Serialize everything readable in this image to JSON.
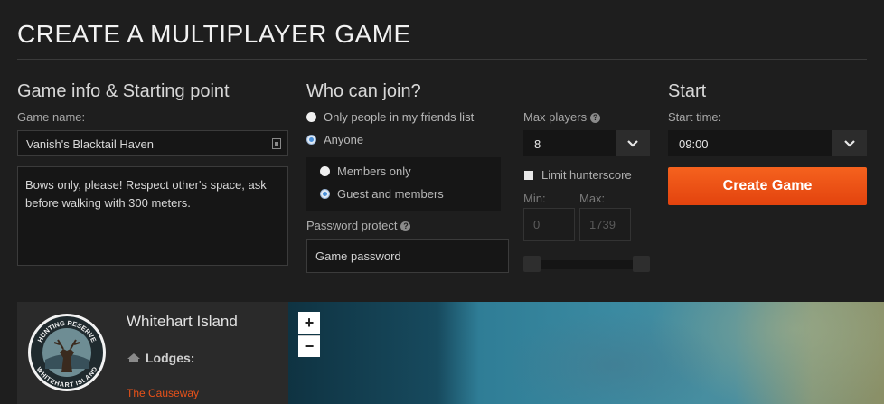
{
  "page": {
    "title": "CREATE A MULTIPLAYER GAME"
  },
  "game_info": {
    "heading": "Game info & Starting point",
    "name_label": "Game name:",
    "name_value": "Vanish's Blacktail Haven",
    "description_value": "Bows only, please! Respect other's space, ask before walking with 300 meters."
  },
  "who_can_join": {
    "heading": "Who can join?",
    "options": [
      {
        "label": "Only people in my friends list",
        "selected": false
      },
      {
        "label": "Anyone",
        "selected": true
      }
    ],
    "sub_options": [
      {
        "label": "Members only",
        "selected": false
      },
      {
        "label": "Guest and members",
        "selected": true
      }
    ],
    "password_label": "Password protect",
    "password_placeholder": "Game password"
  },
  "players": {
    "max_label": "Max players",
    "max_value": "8",
    "limit_label": "Limit hunterscore",
    "min_label": "Min:",
    "max_score_label": "Max:",
    "min_value": "0",
    "max_score_value": "1739"
  },
  "start": {
    "heading": "Start",
    "time_label": "Start time:",
    "time_value": "09:00",
    "create_label": "Create Game"
  },
  "reserve": {
    "name": "Whitehart Island",
    "lodges_label": "Lodges:",
    "lodge_name": "The Causeway",
    "emblem_top": "HUNTING RESERVE",
    "emblem_bottom": "WHITEHART ISLAND"
  },
  "map": {
    "zoom_in": "+",
    "zoom_out": "−"
  },
  "colors": {
    "accent": "#ee5316",
    "lodge": "#e8521a",
    "background": "#1e1e1e"
  }
}
